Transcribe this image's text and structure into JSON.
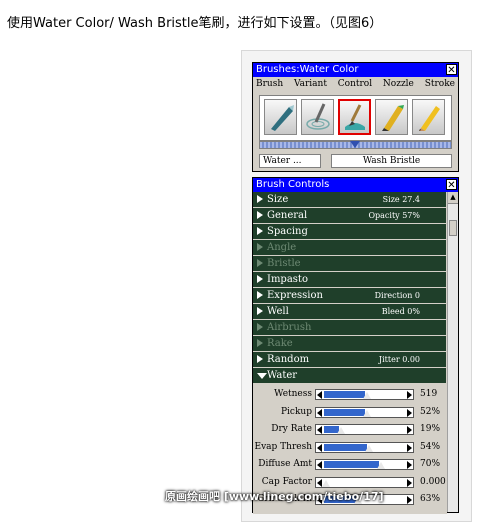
{
  "caption": "使用Water Color/ Wash Bristle笔刷，进行如下设置。（见图6）",
  "brushes_window": {
    "title": "Brushes:Water Color",
    "close": "✕",
    "tabs": [
      "Brush",
      "Variant",
      "Control",
      "Nozzle",
      "Stroke"
    ],
    "icons": [
      "airbrush-icon",
      "water-swirl-icon",
      "wash-brush-icon",
      "felt-pen-icon",
      "pencil-icon"
    ],
    "selected_icon": 2,
    "category_field": "Water ...",
    "variant_field": "Wash Bristle"
  },
  "controls_window": {
    "title": "Brush Controls",
    "close": "✕",
    "sections": [
      {
        "label": "Size",
        "value": "Size 27.4",
        "enabled": true
      },
      {
        "label": "General",
        "value": "Opacity 57%",
        "enabled": true
      },
      {
        "label": "Spacing",
        "value": "",
        "enabled": true
      },
      {
        "label": "Angle",
        "value": "",
        "enabled": false
      },
      {
        "label": "Bristle",
        "value": "",
        "enabled": false
      },
      {
        "label": "Impasto",
        "value": "",
        "enabled": true
      },
      {
        "label": "Expression",
        "value": "Direction 0",
        "enabled": true
      },
      {
        "label": "Well",
        "value": "Bleed 0%",
        "enabled": true
      },
      {
        "label": "Airbrush",
        "value": "",
        "enabled": false
      },
      {
        "label": "Rake",
        "value": "",
        "enabled": false
      },
      {
        "label": "Random",
        "value": "Jitter 0.00",
        "enabled": true
      },
      {
        "label": "Water",
        "value": "",
        "enabled": true,
        "open": true
      }
    ],
    "water_sliders": [
      {
        "label": "Wetness",
        "value": "519",
        "level": 0.52
      },
      {
        "label": "Pickup",
        "value": "52%",
        "level": 0.52
      },
      {
        "label": "Dry Rate",
        "value": "19%",
        "level": 0.19
      },
      {
        "label": "Evap Thresh",
        "value": "54%",
        "level": 0.54
      },
      {
        "label": "Diffuse Amt",
        "value": "70%",
        "level": 0.7
      },
      {
        "label": "Cap Factor",
        "value": "0.000",
        "level": 0.0
      },
      {
        "label": "Grn Soak-In",
        "value": "63%",
        "level": 0.4
      }
    ]
  },
  "watermark": "原画绘画吧 [www.lineg.com/tiebo/17]"
}
